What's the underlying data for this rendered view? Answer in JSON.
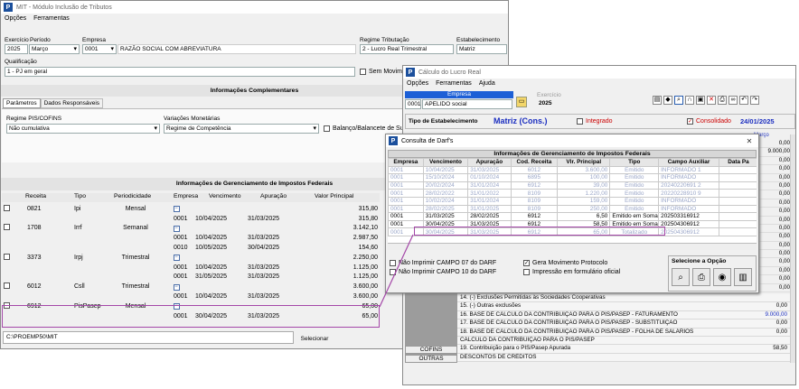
{
  "win1": {
    "title": "MIT - Módulo Inclusão de Tributos",
    "menu": [
      "Opções",
      "Ferramentas"
    ],
    "labels": {
      "exercicio": "Exercício",
      "periodo": "Período",
      "empresa": "Empresa",
      "regime": "Regime Tributação",
      "estab": "Estabelecimento",
      "qualif": "Qualificação",
      "sem_mov": "Sem Movimento"
    },
    "exercicio": "2025",
    "periodo": "Março",
    "empresa_code": "0001",
    "empresa_name": "RAZÃO SOCIAL COM ABREVIATURA",
    "regime": "2 - Lucro Real Trimestral",
    "estab": "Matriz",
    "qualif": "1 - PJ em geral",
    "info_header": "Informações Complementares",
    "tabs": [
      "Parâmetros",
      "Dados Responsáveis"
    ],
    "regime_pis_label": "Regime PIS/COFINS",
    "regime_pis": "Não cumulativa",
    "variacoes_label": "Variações Monetárias",
    "variacoes": "Regime de Competência",
    "balanco": "Balanço/Balancete de Suspe",
    "grid_header": "Informações de Gerenciamento de Impostos Federais",
    "cols": [
      "Receita",
      "Tipo",
      "Periodicidade",
      "Empresa",
      "Vencimento",
      "Apuração",
      "Valor Principal"
    ],
    "rows": [
      {
        "kind": "main",
        "receita": "0821",
        "tipo": "Ipi",
        "period": "Mensal",
        "valor": "315,80"
      },
      {
        "kind": "sub",
        "empresa": "0001",
        "venc": "10/04/2025",
        "apur": "31/03/2025",
        "valor": "315,80"
      },
      {
        "kind": "main",
        "receita": "1708",
        "tipo": "Irrf",
        "period": "Semanal",
        "valor": "3.142,10"
      },
      {
        "kind": "sub",
        "empresa": "0001",
        "venc": "10/04/2025",
        "apur": "31/03/2025",
        "valor": "2.987,50"
      },
      {
        "kind": "sub",
        "empresa": "0010",
        "venc": "10/05/2025",
        "apur": "30/04/2025",
        "valor": "154,60"
      },
      {
        "kind": "main",
        "receita": "3373",
        "tipo": "Irpj",
        "period": "Trimestral",
        "valor": "2.250,00"
      },
      {
        "kind": "sub",
        "empresa": "0001",
        "venc": "10/04/2025",
        "apur": "31/03/2025",
        "valor": "1.125,00"
      },
      {
        "kind": "sub",
        "empresa": "0001",
        "venc": "31/05/2025",
        "apur": "31/03/2025",
        "valor": "1.125,00"
      },
      {
        "kind": "main",
        "receita": "6012",
        "tipo": "Csll",
        "period": "Trimestral",
        "valor": "3.600,00"
      },
      {
        "kind": "sub",
        "empresa": "0001",
        "venc": "10/04/2025",
        "apur": "31/03/2025",
        "valor": "3.600,00"
      },
      {
        "kind": "main",
        "receita": "6912",
        "tipo": "PisPasep",
        "period": "Mensal",
        "valor": "65,00"
      },
      {
        "kind": "sub",
        "empresa": "0001",
        "venc": "30/04/2025",
        "apur": "31/03/2025",
        "valor": "65,00"
      }
    ],
    "status_path": "C:\\PROEMP50\\MIT",
    "select_btn": "Selecionar"
  },
  "win2": {
    "title": "Cálculo do Lucro Real",
    "menu": [
      "Opções",
      "Ferramentas",
      "Ajuda"
    ],
    "empresa_label": "Empresa",
    "empresa_code": "0001",
    "empresa_name": "APELIDO social",
    "exercicio_label": "Exercício",
    "exercicio": "2025",
    "tipo_label": "Tipo de Estabelecimento",
    "tipo": "Matriz (Cons.)",
    "integrado": "Integrado",
    "consolidado": "Consolidado",
    "date": "24/01/2025",
    "marco": "Março",
    "right_values": [
      "0,00",
      "9.000,00",
      "0,00",
      "0,00",
      "0,00",
      "0,00",
      "0,00",
      "0,00",
      "0,00",
      "0,00",
      "0,00",
      "0,00",
      "0,00",
      "0,00",
      "0,00",
      "0,00",
      "0,00",
      "0,00"
    ],
    "lines": [
      {
        "t": "14. (-) Exclusões Permitidas às Sociedades Cooperativas",
        "v": ""
      },
      {
        "t": "15. (-) Outras exclusões",
        "v": "0,00"
      },
      {
        "t": "16. BASE DE CÁLCULO DA CONTRIBUIÇÃO PARA O PIS/PASEP - FATURAMENTO",
        "v": "9.000,00"
      },
      {
        "t": "17. BASE DE CÁLCULO DA CONTRIBUIÇÃO PARA O PIS/PASEP - SUBSTITUIÇÃO",
        "v": "0,00"
      },
      {
        "t": "18. BASE DE CÁLCULO DA CONTRIBUIÇÃO PARA O PIS/PASEP - FOLHA DE SALÁRIOS",
        "v": "0,00"
      },
      {
        "t": "CÁLCULO DA CONTRIBUIÇÃO PARA O PIS/PASEP",
        "v": ""
      },
      {
        "t": "19. Contribuição para o PIS/Pasep Apurada",
        "v": "58,50"
      },
      {
        "t": "DESCONTOS DE CRÉDITOS",
        "v": ""
      }
    ],
    "side_tabs": [
      "COFINS",
      "OUTRAS"
    ]
  },
  "dlg": {
    "title": "Consulta de Darf's",
    "header": "Informações de Gerenciamento de Impostos Federais",
    "cols": [
      "Empresa",
      "Vencimento",
      "Apuração",
      "Cod. Receita",
      "Vlr. Principal",
      "Tipo",
      "Campo Auxiliar",
      "Data Pa"
    ],
    "rows": [
      {
        "g": true,
        "c": [
          "0001",
          "10/04/2025",
          "31/03/2025",
          "6012",
          "3.600,00",
          "Emitido",
          "INFORMADO 1",
          ""
        ]
      },
      {
        "g": true,
        "c": [
          "0001",
          "15/10/2024",
          "01/10/2024",
          "6895",
          "100,00",
          "Emitido",
          "INFORMADO",
          ""
        ]
      },
      {
        "g": true,
        "c": [
          "0001",
          "20/02/2024",
          "31/01/2024",
          "6912",
          "39,00",
          "Emitido",
          "20240220691 2",
          ""
        ]
      },
      {
        "g": true,
        "c": [
          "0001",
          "28/02/2022",
          "31/01/2022",
          "8109",
          "1.220,00",
          "Emitido",
          "20220228910 9",
          ""
        ]
      },
      {
        "g": true,
        "c": [
          "0001",
          "10/02/2024",
          "31/01/2024",
          "8109",
          "159,00",
          "Emitido",
          "INFORMADO",
          ""
        ]
      },
      {
        "g": true,
        "c": [
          "0001",
          "28/02/2025",
          "31/01/2025",
          "8109",
          "250,00",
          "Emitido",
          "INFORMADO",
          ""
        ]
      },
      {
        "g": false,
        "c": [
          "0001",
          "31/03/2025",
          "28/02/2025",
          "6912",
          "6,50",
          "Emitido em Soma",
          "202503316912",
          ""
        ]
      },
      {
        "g": false,
        "c": [
          "0001",
          "30/04/2025",
          "31/03/2025",
          "6912",
          "58,50",
          "Emitido em Soma",
          "202504306912",
          ""
        ]
      },
      {
        "g": true,
        "c": [
          "0001",
          "30/04/2025",
          "31/03/2025",
          "6912",
          "65,00",
          "Totalizado",
          "202504306912",
          ""
        ]
      }
    ],
    "opts": [
      "Não Imprimir CAMPO 07 do DARF",
      "Gera Movimento Protocolo",
      "Não Imprimir CAMPO 10 do DARF",
      "Impressão em formulário oficial"
    ],
    "select_label": "Selecione a Opção"
  }
}
